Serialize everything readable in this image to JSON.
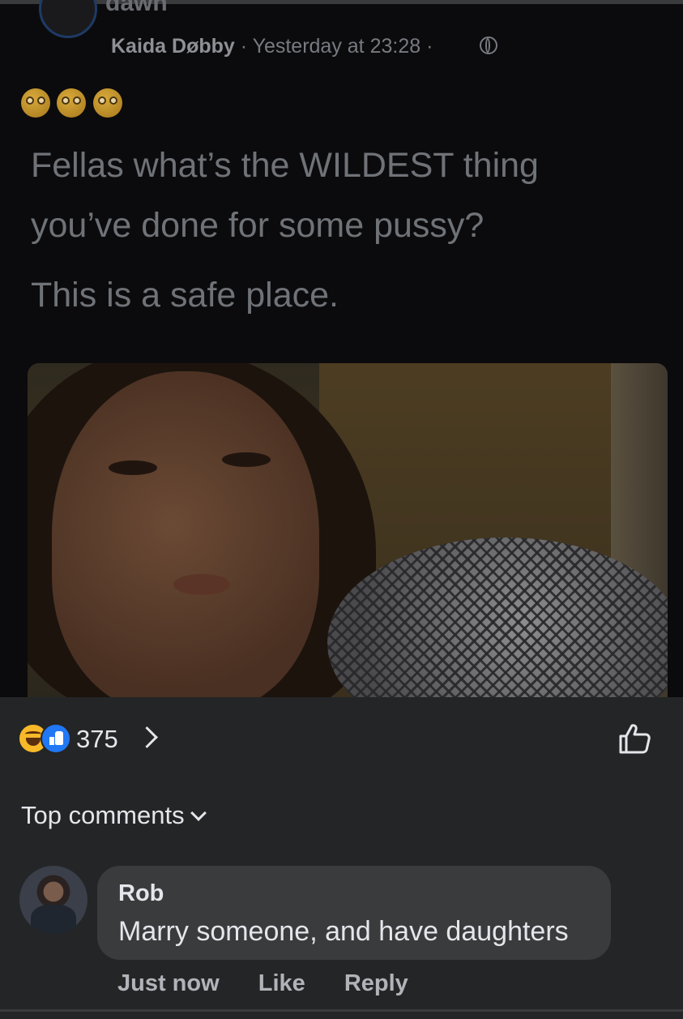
{
  "post": {
    "group_name_cut": "dawn",
    "author": "Kaida Døbby",
    "separator": " · ",
    "timestamp": "Yesterday at 23:28",
    "separator2": " · ",
    "emoji_count": 3,
    "text_lines": [
      "Fellas what’s the WILDEST thing",
      "you’ve done for some pussy?",
      "This is a safe place."
    ]
  },
  "reactions": {
    "count": "375",
    "icons": [
      "haha-icon",
      "like-icon",
      "chevron-right-icon"
    ]
  },
  "comments": {
    "section_label": "Top comments",
    "items": [
      {
        "author": "Rob",
        "text": "Marry someone, and have daughters",
        "time": "Just now",
        "like_label": "Like",
        "reply_label": "Reply"
      }
    ]
  },
  "colors": {
    "background": "#242526",
    "post_background": "#0b0b0d",
    "bubble": "#3a3b3c",
    "like_blue": "#2078f4",
    "haha_yellow": "#f7b928"
  }
}
